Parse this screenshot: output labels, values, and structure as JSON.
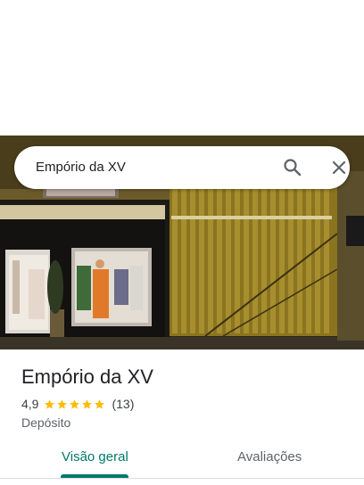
{
  "search": {
    "query": "Empório da XV"
  },
  "icons": {
    "search": "search-icon",
    "close": "close-icon",
    "star": "star-icon"
  },
  "place": {
    "name": "Empório da XV",
    "rating": "4,9",
    "rating_stars": 5,
    "review_count": "(13)",
    "category": "Depósito"
  },
  "tabs": [
    {
      "label": "Visão geral",
      "active": true
    },
    {
      "label": "Avaliações",
      "active": false
    }
  ],
  "colors": {
    "accent": "#00796b",
    "star": "#fbbc04",
    "title": "#202124",
    "muted": "#5f6368"
  }
}
